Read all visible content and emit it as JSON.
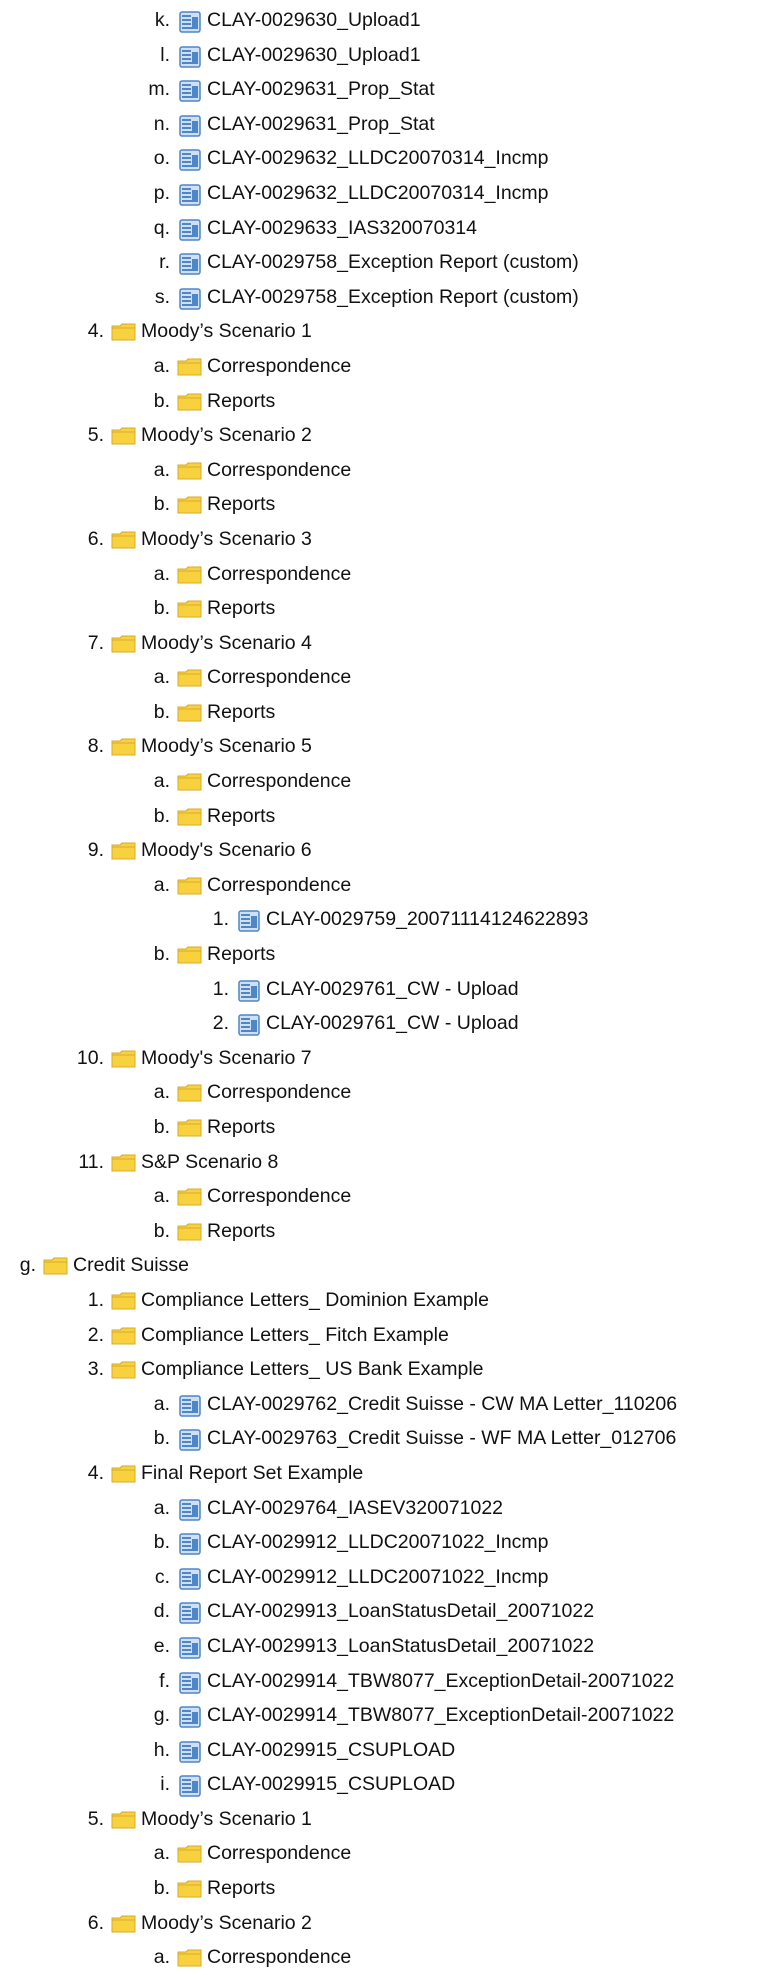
{
  "colors": {
    "folder": "#f7d23e",
    "folder_edge": "#d8a92a",
    "doc": "#4f86c6",
    "doc_light": "#cfe0f5"
  },
  "tree": [
    {
      "lvl": 3,
      "m": "k.",
      "icon": "doc",
      "t": "CLAY-0029630_Upload1"
    },
    {
      "lvl": 3,
      "m": "l.",
      "icon": "doc",
      "t": "CLAY-0029630_Upload1"
    },
    {
      "lvl": 3,
      "m": "m.",
      "icon": "doc",
      "t": "CLAY-0029631_Prop_Stat"
    },
    {
      "lvl": 3,
      "m": "n.",
      "icon": "doc",
      "t": "CLAY-0029631_Prop_Stat"
    },
    {
      "lvl": 3,
      "m": "o.",
      "icon": "doc",
      "t": "CLAY-0029632_LLDC20070314_Incmp"
    },
    {
      "lvl": 3,
      "m": "p.",
      "icon": "doc",
      "t": "CLAY-0029632_LLDC20070314_Incmp"
    },
    {
      "lvl": 3,
      "m": "q.",
      "icon": "doc",
      "t": "CLAY-0029633_IAS320070314"
    },
    {
      "lvl": 3,
      "m": "r.",
      "icon": "doc",
      "t": "CLAY-0029758_Exception Report (custom)"
    },
    {
      "lvl": 3,
      "m": "s.",
      "icon": "doc",
      "t": "CLAY-0029758_Exception Report (custom)"
    },
    {
      "lvl": 2,
      "m": "4.",
      "icon": "folder",
      "t": "Moody’s Scenario 1"
    },
    {
      "lvl": 3,
      "m": "a.",
      "icon": "folder",
      "t": "Correspondence"
    },
    {
      "lvl": 3,
      "m": "b.",
      "icon": "folder",
      "t": "Reports"
    },
    {
      "lvl": 2,
      "m": "5.",
      "icon": "folder",
      "t": "Moody’s Scenario 2"
    },
    {
      "lvl": 3,
      "m": "a.",
      "icon": "folder",
      "t": "Correspondence"
    },
    {
      "lvl": 3,
      "m": "b.",
      "icon": "folder",
      "t": "Reports"
    },
    {
      "lvl": 2,
      "m": "6.",
      "icon": "folder",
      "t": "Moody’s Scenario 3"
    },
    {
      "lvl": 3,
      "m": "a.",
      "icon": "folder",
      "t": "Correspondence"
    },
    {
      "lvl": 3,
      "m": "b.",
      "icon": "folder",
      "t": "Reports"
    },
    {
      "lvl": 2,
      "m": "7.",
      "icon": "folder",
      "t": "Moody’s Scenario 4"
    },
    {
      "lvl": 3,
      "m": "a.",
      "icon": "folder",
      "t": "Correspondence"
    },
    {
      "lvl": 3,
      "m": "b.",
      "icon": "folder",
      "t": "Reports"
    },
    {
      "lvl": 2,
      "m": "8.",
      "icon": "folder",
      "t": "Moody’s Scenario 5"
    },
    {
      "lvl": 3,
      "m": "a.",
      "icon": "folder",
      "t": "Correspondence"
    },
    {
      "lvl": 3,
      "m": "b.",
      "icon": "folder",
      "t": "Reports"
    },
    {
      "lvl": 2,
      "m": "9.",
      "icon": "folder",
      "t": "Moody's Scenario 6"
    },
    {
      "lvl": 3,
      "m": "a.",
      "icon": "folder",
      "t": "Correspondence"
    },
    {
      "lvl": 4,
      "m": "1.",
      "icon": "doc",
      "t": "CLAY-0029759_20071114124622893"
    },
    {
      "lvl": 3,
      "m": "b.",
      "icon": "folder",
      "t": "Reports"
    },
    {
      "lvl": 4,
      "m": "1.",
      "icon": "doc",
      "t": "CLAY-0029761_CW - Upload"
    },
    {
      "lvl": 4,
      "m": "2.",
      "icon": "doc",
      "t": "CLAY-0029761_CW - Upload"
    },
    {
      "lvl": 2,
      "m": "10.",
      "icon": "folder",
      "t": "Moody's Scenario 7"
    },
    {
      "lvl": 3,
      "m": "a.",
      "icon": "folder",
      "t": "Correspondence"
    },
    {
      "lvl": 3,
      "m": "b.",
      "icon": "folder",
      "t": "Reports"
    },
    {
      "lvl": 2,
      "m": "11.",
      "icon": "folder",
      "t": "S&P Scenario 8"
    },
    {
      "lvl": 3,
      "m": "a.",
      "icon": "folder",
      "t": "Correspondence"
    },
    {
      "lvl": 3,
      "m": "b.",
      "icon": "folder",
      "t": "Reports"
    },
    {
      "lvl": 1,
      "m": "g.",
      "icon": "folder",
      "t": "Credit Suisse"
    },
    {
      "lvl": 2,
      "m": "1.",
      "icon": "folder",
      "t": "Compliance Letters_ Dominion Example"
    },
    {
      "lvl": 2,
      "m": "2.",
      "icon": "folder",
      "t": "Compliance Letters_ Fitch Example"
    },
    {
      "lvl": 2,
      "m": "3.",
      "icon": "folder",
      "t": "Compliance Letters_ US Bank Example"
    },
    {
      "lvl": 3,
      "m": "a.",
      "icon": "doc",
      "t": "CLAY-0029762_Credit Suisse - CW MA Letter_110206"
    },
    {
      "lvl": 3,
      "m": "b.",
      "icon": "doc",
      "t": "CLAY-0029763_Credit Suisse - WF MA Letter_012706"
    },
    {
      "lvl": 2,
      "m": "4.",
      "icon": "folder",
      "t": "Final Report Set Example"
    },
    {
      "lvl": 3,
      "m": "a.",
      "icon": "doc",
      "t": "CLAY-0029764_IASEV320071022"
    },
    {
      "lvl": 3,
      "m": "b.",
      "icon": "doc",
      "t": "CLAY-0029912_LLDC20071022_Incmp"
    },
    {
      "lvl": 3,
      "m": "c.",
      "icon": "doc",
      "t": "CLAY-0029912_LLDC20071022_Incmp"
    },
    {
      "lvl": 3,
      "m": "d.",
      "icon": "doc",
      "t": "CLAY-0029913_LoanStatusDetail_20071022"
    },
    {
      "lvl": 3,
      "m": "e.",
      "icon": "doc",
      "t": "CLAY-0029913_LoanStatusDetail_20071022"
    },
    {
      "lvl": 3,
      "m": "f.",
      "icon": "doc",
      "t": "CLAY-0029914_TBW8077_ExceptionDetail-20071022"
    },
    {
      "lvl": 3,
      "m": "g.",
      "icon": "doc",
      "t": "CLAY-0029914_TBW8077_ExceptionDetail-20071022"
    },
    {
      "lvl": 3,
      "m": "h.",
      "icon": "doc",
      "t": "CLAY-0029915_CSUPLOAD"
    },
    {
      "lvl": 3,
      "m": "i.",
      "icon": "doc",
      "t": "CLAY-0029915_CSUPLOAD"
    },
    {
      "lvl": 2,
      "m": "5.",
      "icon": "folder",
      "t": "Moody’s Scenario 1"
    },
    {
      "lvl": 3,
      "m": "a.",
      "icon": "folder",
      "t": "Correspondence"
    },
    {
      "lvl": 3,
      "m": "b.",
      "icon": "folder",
      "t": "Reports"
    },
    {
      "lvl": 2,
      "m": "6.",
      "icon": "folder",
      "t": "Moody’s Scenario 2"
    },
    {
      "lvl": 3,
      "m": "a.",
      "icon": "folder",
      "t": "Correspondence"
    }
  ]
}
